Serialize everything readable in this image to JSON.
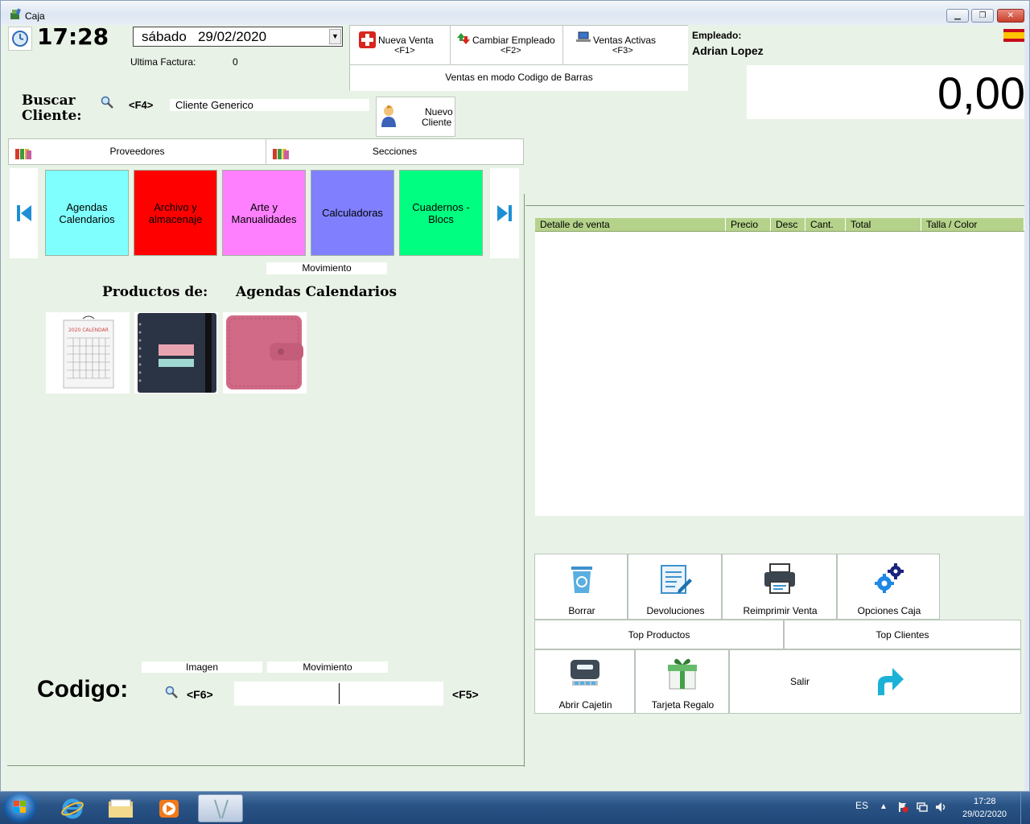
{
  "window": {
    "title": "Caja"
  },
  "clock": {
    "time": "17:28"
  },
  "date": {
    "selected": "sábado   29/02/2020"
  },
  "invoice": {
    "label": "Ultima Factura:",
    "value": "0"
  },
  "actions": {
    "new_sale": {
      "label": "Nueva Venta",
      "key": "<F1>"
    },
    "change_employee": {
      "label": "Cambiar Empleado",
      "key": "<F2>"
    },
    "active_sales": {
      "label": "Ventas Activas",
      "key": "<F3>"
    },
    "barcode_mode": "Ventas en modo Codigo de Barras"
  },
  "employee": {
    "label": "Empleado:",
    "name": "Adrian Lopez"
  },
  "total": {
    "amount": "0,00"
  },
  "customer": {
    "label_line1": "Buscar",
    "label_line2": "Cliente:",
    "key": "<F4>",
    "current": "Cliente Generico",
    "new_button_line1": "Nuevo",
    "new_button_line2": "Cliente"
  },
  "filters": {
    "suppliers": "Proveedores",
    "sections": "Secciones"
  },
  "categories": [
    {
      "line1": "Agendas",
      "line2": "Calendarios",
      "color": "#80ffff"
    },
    {
      "line1": "Archivo y",
      "line2": "almacenaje",
      "color": "#ff0000"
    },
    {
      "line1": "Arte y",
      "line2": "Manualidades",
      "color": "#ff80ff"
    },
    {
      "line1": "Calculadoras",
      "line2": "",
      "color": "#8080ff"
    },
    {
      "line1": "Cuadernos -",
      "line2": "Blocs",
      "color": "#00ff80"
    }
  ],
  "movement_label": "Movimiento",
  "products": {
    "heading": "Productos de:",
    "category": "Agendas Calendarios"
  },
  "image_label": "Imagen",
  "movement_label_2": "Movimiento",
  "code": {
    "label": "Codigo:",
    "key_search": "<F6>",
    "key_enter": "<F5>",
    "value": ""
  },
  "sale_table": {
    "columns": [
      "Detalle de venta",
      "Precio",
      "Desc",
      "Cant.",
      "Total",
      "Talla / Color"
    ],
    "rows": []
  },
  "tools": {
    "delete": "Borrar",
    "returns": "Devoluciones",
    "reprint": "Reimprimir Venta",
    "options": "Opciones Caja",
    "top_products": "Top Productos",
    "top_clients": "Top Clientes",
    "open_drawer": "Abrir Cajetin",
    "gift_card": "Tarjeta Regalo",
    "exit": "Salir"
  },
  "taskbar": {
    "lang": "ES",
    "time": "17:28",
    "date": "29/02/2020"
  },
  "colors": {
    "background": "#e9f2e7",
    "table_header": "#b5d28a",
    "accent": "#00aadd"
  }
}
